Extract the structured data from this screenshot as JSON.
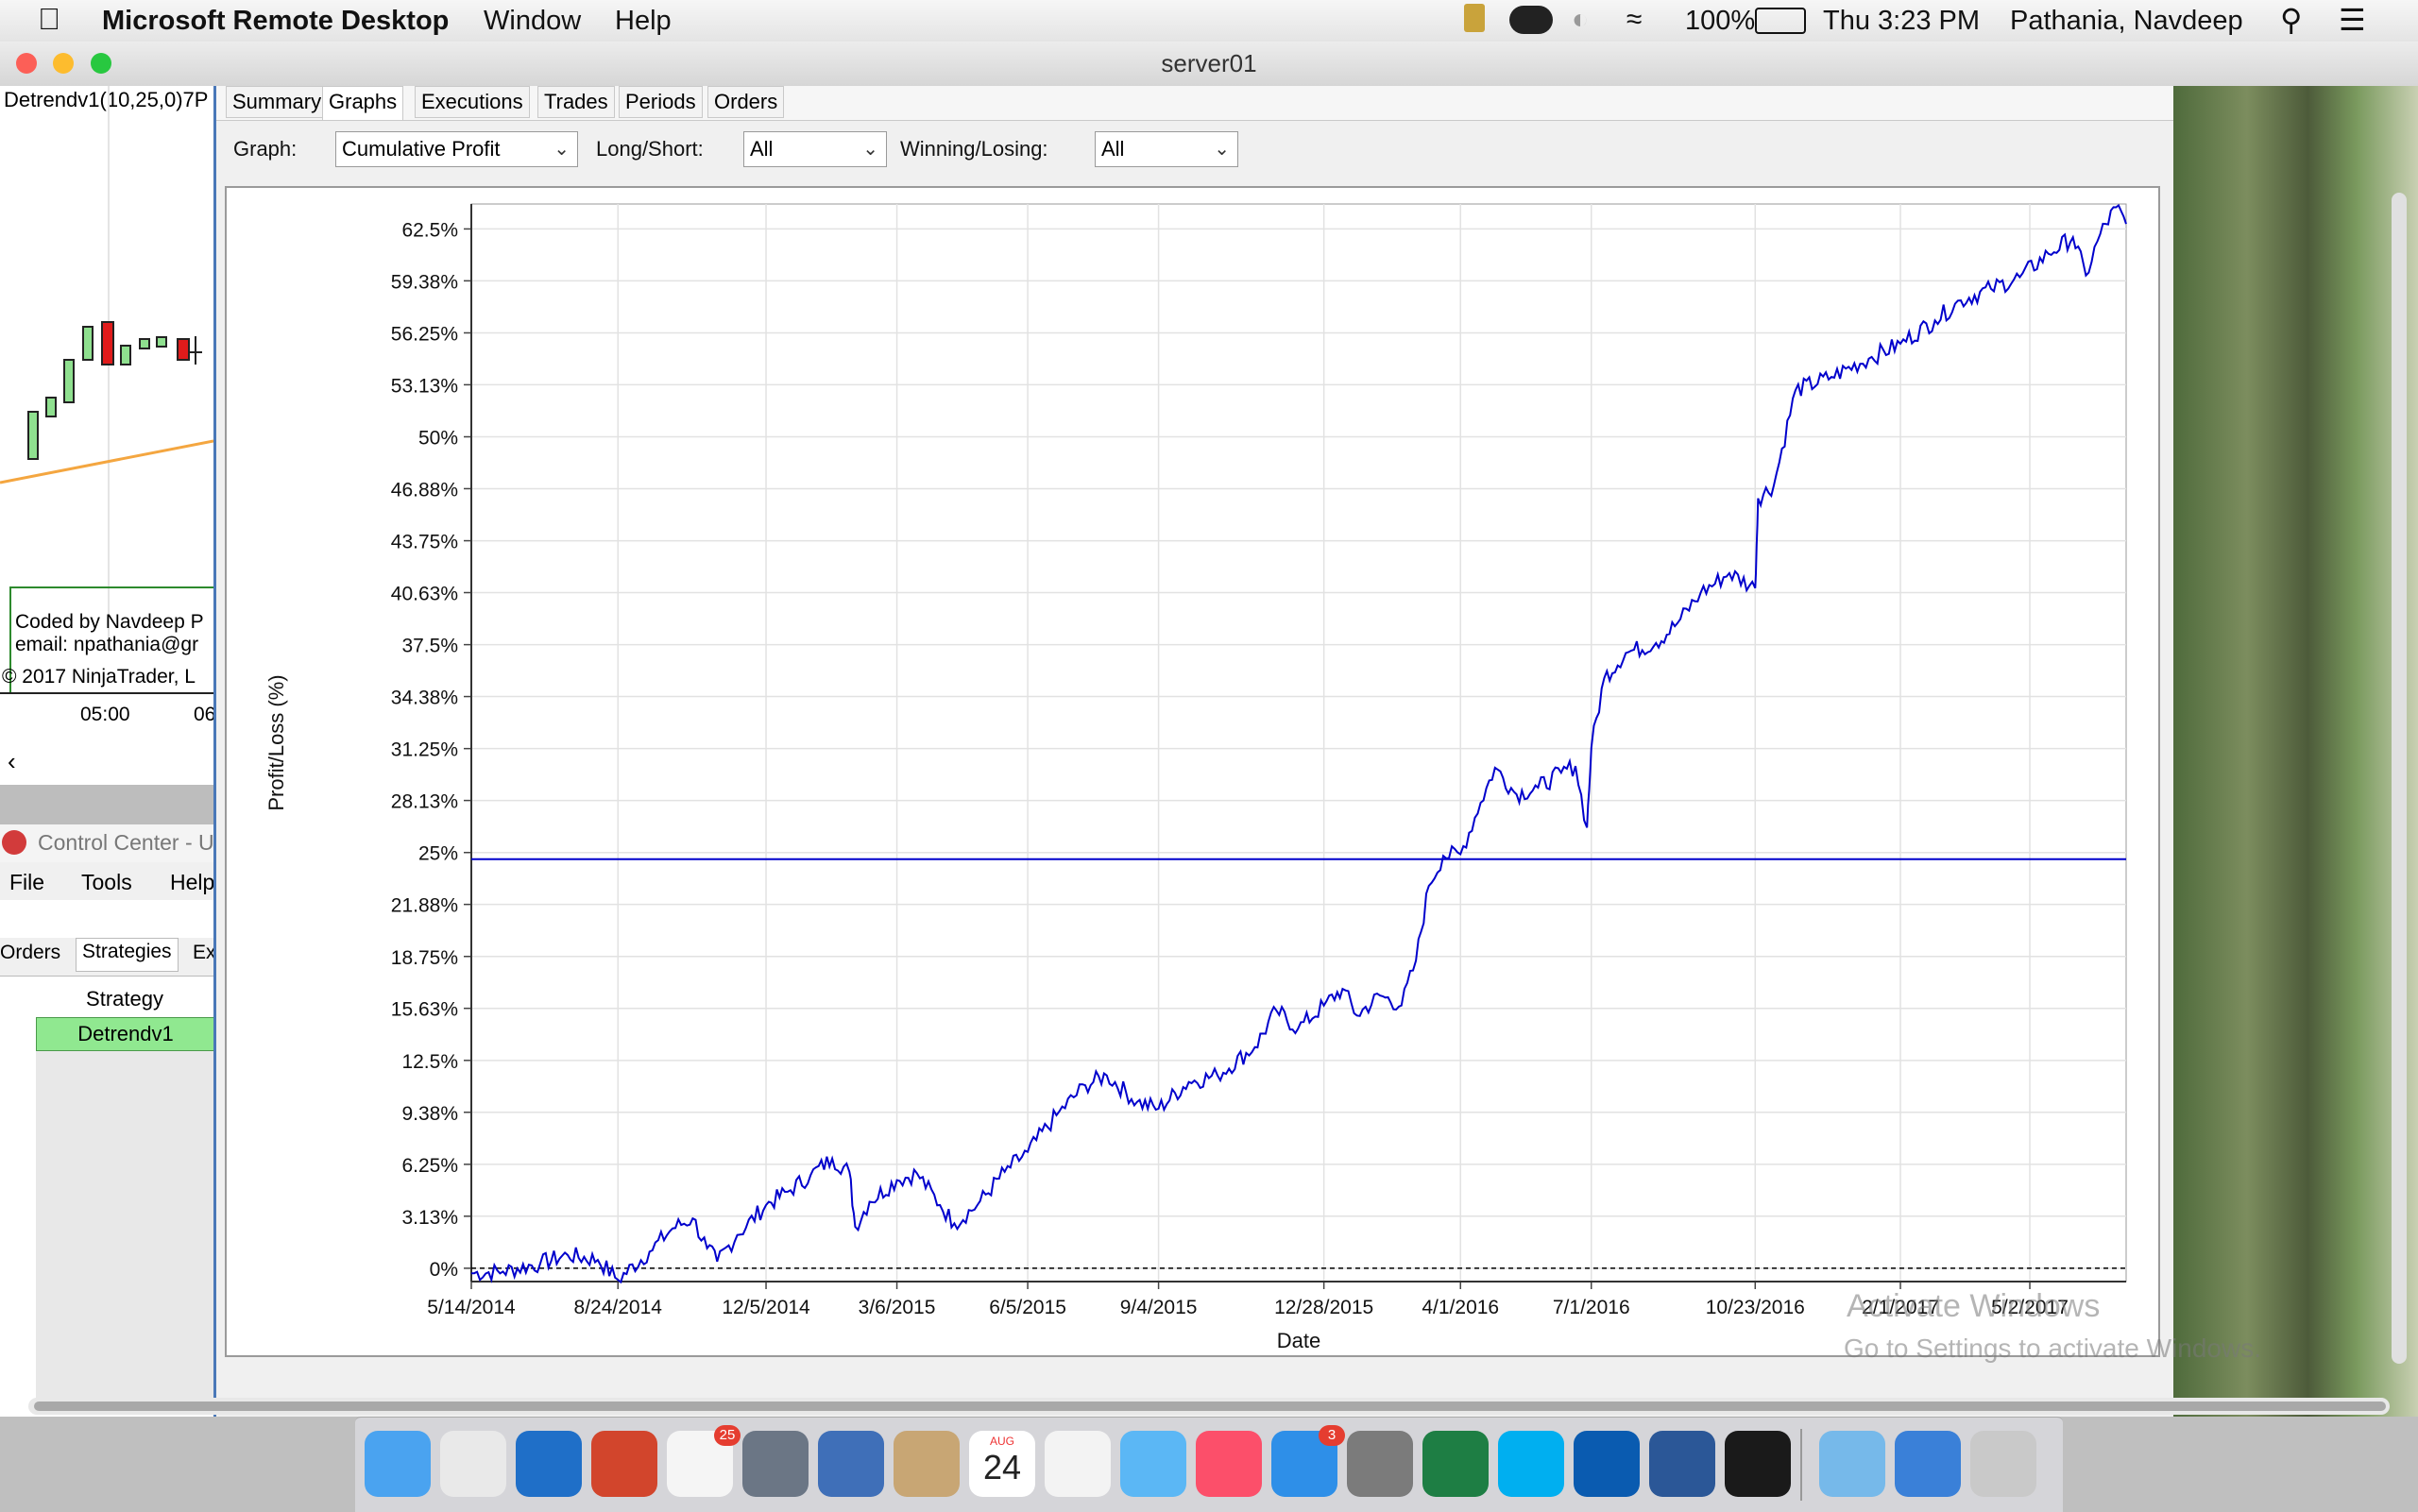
{
  "menubar": {
    "app": "Microsoft Remote Desktop",
    "window": "Window",
    "help": "Help",
    "battery": "100%",
    "clock": "Thu 3:23 PM",
    "user": "Pathania, Navdeep"
  },
  "window": {
    "title": "server01"
  },
  "left_app": {
    "chart_label": "Detrendv1(10,25,0)7P",
    "note_line1": "Coded by Navdeep P",
    "note_line2": "email: npathania@gr",
    "copyright": "© 2017 NinjaTrader, L",
    "time_tick1": "05:00",
    "time_tick2": "06",
    "control_center": "Control Center - U",
    "menu_file": "File",
    "menu_tools": "Tools",
    "menu_help": "Help",
    "tab_orders": "Orders",
    "tab_strategies": "Strategies",
    "tab_ex": "Ex",
    "col_strategy": "Strategy",
    "row_strategy": "Detrendv1"
  },
  "analyzer": {
    "tabs": [
      "Summary",
      "Graphs",
      "Executions",
      "Trades",
      "Periods",
      "Orders"
    ],
    "active_tab": "Graphs",
    "graph_label": "Graph:",
    "graph_value": "Cumulative Profit",
    "longshort_label": "Long/Short:",
    "longshort_value": "All",
    "winlose_label": "Winning/Losing:",
    "winlose_value": "All"
  },
  "chart_data": {
    "type": "line",
    "xlabel": "Date",
    "ylabel": "Profit/Loss (%)",
    "x_ticks": [
      "5/14/2014",
      "8/24/2014",
      "12/5/2014",
      "3/6/2015",
      "6/5/2015",
      "9/4/2015",
      "12/28/2015",
      "4/1/2016",
      "7/1/2016",
      "10/23/2016",
      "2/1/2017",
      "5/2/2017"
    ],
    "y_ticks": [
      "0%",
      "3.13%",
      "6.25%",
      "9.38%",
      "12.5%",
      "15.63%",
      "18.75%",
      "21.88%",
      "25%",
      "28.13%",
      "31.25%",
      "34.38%",
      "37.5%",
      "40.63%",
      "43.75%",
      "46.88%",
      "50%",
      "53.13%",
      "56.25%",
      "59.38%",
      "62.5%"
    ],
    "ylim": [
      -0.8,
      64
    ],
    "xlim": [
      "2014-05-14",
      "2017-07-08"
    ],
    "reference_line": 24.6,
    "zero_line": 0,
    "series_color": "#0000cc",
    "points": [
      [
        "2014-05-14",
        -0.3
      ],
      [
        "2014-06-05",
        -0.2
      ],
      [
        "2014-07-01",
        0.3
      ],
      [
        "2014-07-20",
        0.8
      ],
      [
        "2014-08-10",
        0.5
      ],
      [
        "2014-08-24",
        -0.7
      ],
      [
        "2014-09-15",
        1.0
      ],
      [
        "2014-10-01",
        2.4
      ],
      [
        "2014-10-15",
        3.0
      ],
      [
        "2014-10-25",
        1.2
      ],
      [
        "2014-11-01",
        0.4
      ],
      [
        "2014-11-15",
        2.0
      ],
      [
        "2014-12-05",
        3.8
      ],
      [
        "2014-12-20",
        4.6
      ],
      [
        "2015-01-05",
        5.6
      ],
      [
        "2015-01-20",
        6.6
      ],
      [
        "2015-02-01",
        5.8
      ],
      [
        "2015-02-05",
        2.5
      ],
      [
        "2015-02-15",
        4.0
      ],
      [
        "2015-03-06",
        5.3
      ],
      [
        "2015-03-20",
        5.7
      ],
      [
        "2015-04-05",
        3.8
      ],
      [
        "2015-04-15",
        2.7
      ],
      [
        "2015-05-01",
        3.8
      ],
      [
        "2015-05-20",
        5.8
      ],
      [
        "2015-06-05",
        7.0
      ],
      [
        "2015-06-25",
        9.2
      ],
      [
        "2015-07-15",
        11.0
      ],
      [
        "2015-07-30",
        11.6
      ],
      [
        "2015-08-20",
        10.0
      ],
      [
        "2015-09-04",
        9.6
      ],
      [
        "2015-09-25",
        11.2
      ],
      [
        "2015-10-15",
        11.6
      ],
      [
        "2015-11-10",
        13.3
      ],
      [
        "2015-11-25",
        15.5
      ],
      [
        "2015-12-10",
        14.4
      ],
      [
        "2015-12-28",
        15.8
      ],
      [
        "2016-01-10",
        16.8
      ],
      [
        "2016-01-20",
        15.2
      ],
      [
        "2016-02-05",
        16.4
      ],
      [
        "2016-02-20",
        15.8
      ],
      [
        "2016-03-01",
        18.5
      ],
      [
        "2016-03-10",
        23.0
      ],
      [
        "2016-03-20",
        24.8
      ],
      [
        "2016-04-01",
        24.9
      ],
      [
        "2016-04-15",
        28.0
      ],
      [
        "2016-04-25",
        30.1
      ],
      [
        "2016-05-10",
        28.5
      ],
      [
        "2016-05-25",
        28.9
      ],
      [
        "2016-06-10",
        29.8
      ],
      [
        "2016-06-20",
        30.2
      ],
      [
        "2016-06-28",
        26.5
      ],
      [
        "2016-07-01",
        31.3
      ],
      [
        "2016-07-10",
        35.5
      ],
      [
        "2016-07-25",
        37.0
      ],
      [
        "2016-08-15",
        37.6
      ],
      [
        "2016-08-30",
        38.8
      ],
      [
        "2016-09-15",
        40.6
      ],
      [
        "2016-10-05",
        41.8
      ],
      [
        "2016-10-23",
        40.9
      ],
      [
        "2016-10-25",
        46.3
      ],
      [
        "2016-11-05",
        47.1
      ],
      [
        "2016-11-20",
        52.8
      ],
      [
        "2016-12-15",
        53.6
      ],
      [
        "2017-01-10",
        54.7
      ],
      [
        "2017-02-01",
        55.6
      ],
      [
        "2017-02-25",
        57.0
      ],
      [
        "2017-03-15",
        58.2
      ],
      [
        "2017-04-05",
        58.9
      ],
      [
        "2017-04-25",
        59.6
      ],
      [
        "2017-05-15",
        61.0
      ],
      [
        "2017-06-01",
        62.0
      ],
      [
        "2017-06-10",
        59.7
      ],
      [
        "2017-06-20",
        62.2
      ],
      [
        "2017-07-01",
        63.8
      ],
      [
        "2017-07-08",
        62.8
      ]
    ]
  },
  "desktop": {
    "watermark_line1": "Activate Windows",
    "watermark_line2": "Go to Settings to activate Windows."
  },
  "dock": {
    "icons": [
      "finder-icon",
      "chrome-icon",
      "outlook-icon",
      "remote-desktop-icon",
      "slack-icon",
      "launchpad-icon",
      "preview-icon",
      "contacts-icon",
      "calendar-icon",
      "photos-icon",
      "messages-icon",
      "itunes-icon",
      "app-store-icon",
      "system-preferences-icon",
      "excel-icon",
      "skype-icon",
      "sap-icon",
      "word-icon",
      "scrivener-icon",
      "downloads-folder-icon",
      "globe-icon",
      "trash-icon"
    ],
    "slack_badge": "25",
    "appstore_badge": "3",
    "calendar_month": "AUG",
    "calendar_day": "24"
  }
}
